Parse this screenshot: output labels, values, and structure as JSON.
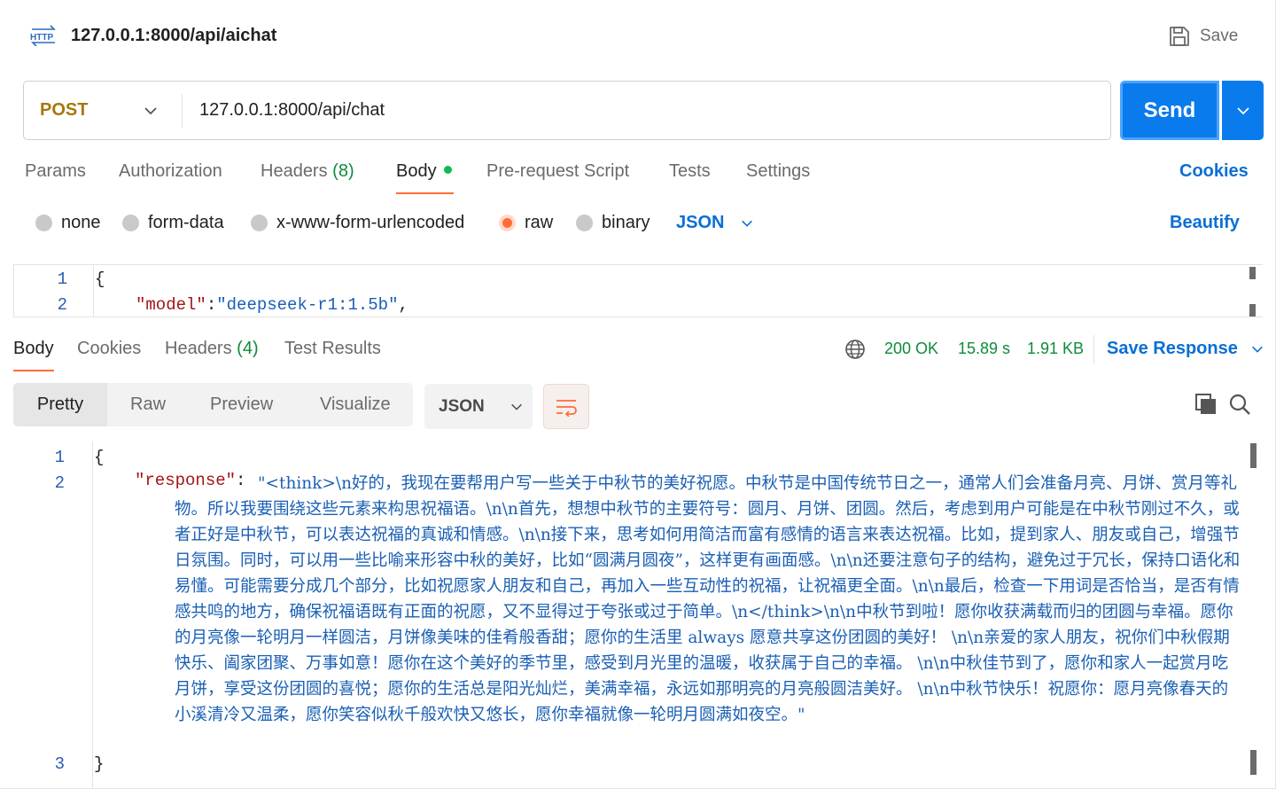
{
  "header": {
    "http_badge": "HTTP",
    "title": "127.0.0.1:8000/api/aichat",
    "save_label": "Save"
  },
  "request": {
    "method": "POST",
    "url": "127.0.0.1:8000/api/chat",
    "send_label": "Send"
  },
  "request_tabs": {
    "params": "Params",
    "authorization": "Authorization",
    "headers": "Headers",
    "headers_count": "(8)",
    "body": "Body",
    "pre_request": "Pre-request Script",
    "tests": "Tests",
    "settings": "Settings",
    "cookies": "Cookies"
  },
  "body_types": {
    "none": "none",
    "form_data": "form-data",
    "urlencoded": "x-www-form-urlencoded",
    "raw": "raw",
    "binary": "binary",
    "selected": "raw",
    "format": "JSON",
    "beautify": "Beautify"
  },
  "request_body": {
    "lines": [
      "1",
      "2"
    ],
    "line1": "{",
    "line2_key": "\"model\"",
    "line2_colon": ":",
    "line2_value": "\"deepseek-r1:1.5b\"",
    "line2_comma": ","
  },
  "response_tabs": {
    "body": "Body",
    "cookies": "Cookies",
    "headers": "Headers",
    "headers_count": "(4)",
    "test_results": "Test Results"
  },
  "response_status": {
    "status": "200 OK",
    "time": "15.89 s",
    "size": "1.91 KB",
    "save_response": "Save Response"
  },
  "view_modes": {
    "pretty": "Pretty",
    "raw": "Raw",
    "preview": "Preview",
    "visualize": "Visualize",
    "format": "JSON"
  },
  "response_body": {
    "lines": [
      "1",
      "2",
      "3"
    ],
    "open_brace": "{",
    "close_brace": "}",
    "key": "\"response\"",
    "colon": ": ",
    "value": "\"<think>\\n好的，我现在要帮用户写一些关于中秋节的美好祝愿。中秋节是中国传统节日之一，通常人们会准备月亮、月饼、赏月等礼物。所以我要围绕这些元素来构思祝福语。\\n\\n首先，想想中秋节的主要符号：圆月、月饼、团圆。然后，考虑到用户可能是在中秋节刚过不久，或者正好是中秋节，可以表达祝福的真诚和情感。\\n\\n接下来，思考如何用简洁而富有感情的语言来表达祝福。比如，提到家人、朋友或自己，增强节日氛围。同时，可以用一些比喻来形容中秋的美好，比如“圆满月圆夜”，这样更有画面感。\\n\\n还要注意句子的结构，避免过于冗长，保持口语化和易懂。可能需要分成几个部分，比如祝愿家人朋友和自己，再加入一些互动性的祝福，让祝福更全面。\\n\\n最后，检查一下用词是否恰当，是否有情感共鸣的地方，确保祝福语既有正面的祝愿，又不显得过于夸张或过于简单。\\n</think>\\n\\n中秋节到啦！愿你收获满载而归的团圆与幸福。愿你的月亮像一轮明月一样圆洁，月饼像美味的佳肴般香甜；愿你的生活里 always 愿意共享这份团圆的美好！  \\n\\n亲爱的家人朋友，祝你们中秋假期快乐、阖家团聚、万事如意！愿你在这个美好的季节里，感受到月光里的温暖，收获属于自己的幸福。  \\n\\n中秋佳节到了，愿你和家人一起赏月吃月饼，享受这份团圆的喜悦；愿你的生活总是阳光灿烂，美满幸福，永远如那明亮的月亮般圆洁美好。  \\n\\n中秋节快乐！祝愿你：愿月亮像春天的小溪清冷又温柔，愿你笑容似秋千般欢快又悠长，愿你幸福就像一轮明月圆满如夜空。\""
  },
  "icons": {
    "http": "http-icon",
    "save": "floppy-disk-icon",
    "chevron": "chevron-down-icon",
    "globe": "globe-icon",
    "wrap": "word-wrap-icon",
    "copy": "copy-icon",
    "search": "search-icon"
  },
  "colors": {
    "accent": "#ff6c37",
    "primary": "#097bed",
    "link": "#0a6fd4",
    "success": "#0f8a3a",
    "method_post": "#a6780b"
  }
}
